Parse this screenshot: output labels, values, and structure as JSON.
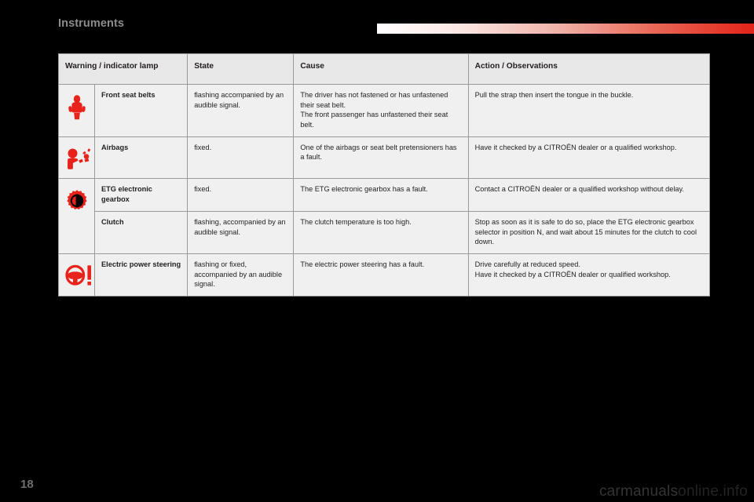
{
  "header": {
    "section_title": "Instruments",
    "gradient_from": "#ffffff",
    "gradient_to": "#e2231a"
  },
  "table": {
    "columns": [
      "Warning / indicator lamp",
      "State",
      "Cause",
      "Action / Observations"
    ],
    "rows": [
      {
        "icon": "seat-belt-warning-icon",
        "lamp": "Front seat belts",
        "state": "flashing accompanied by an audible signal.",
        "cause": "The driver has not fastened or has unfastened their seat belt.\nThe front passenger has unfastened their seat belt.",
        "action": "Pull the strap then insert the tongue in the buckle."
      },
      {
        "icon": "airbag-warning-icon",
        "lamp": "Airbags",
        "state": "fixed.",
        "cause": "One of the airbags or seat belt pretensioners has a fault.",
        "action": "Have it checked by a CITROËN dealer or a qualified workshop."
      },
      {
        "icon": "etg-gearbox-warning-icon",
        "lamp": "ETG electronic gearbox",
        "state": "fixed.",
        "cause": "The ETG electronic gearbox has a fault.",
        "action": "Contact a CITROËN dealer or a qualified workshop without delay."
      },
      {
        "icon": "",
        "lamp": "Clutch",
        "state": "flashing, accompanied by an audible signal.",
        "cause": "The clutch temperature is too high.",
        "action": "Stop as soon as it is safe to do so, place the ETG electronic gearbox selector in position N, and wait about 15 minutes for the clutch to cool down."
      },
      {
        "icon": "power-steering-warning-icon",
        "lamp": "Electric power steering",
        "state": "flashing or fixed, accompanied by an audible signal.",
        "cause": "The electric power steering has a fault.",
        "action": "Drive carefully at reduced speed.\nHave it checked by a CITROËN dealer or qualified workshop."
      }
    ]
  },
  "footer": {
    "page_number": "18",
    "watermark_bold": "carmanuals",
    "watermark_dim": "online.info"
  },
  "colors": {
    "icon_red": "#e8231c",
    "table_border": "#9a9a9a",
    "header_fill": "#e8e8e8",
    "cell_fill": "#f0f0f0",
    "dark_fill": "#000000",
    "title_grey": "#8c8c8c"
  }
}
